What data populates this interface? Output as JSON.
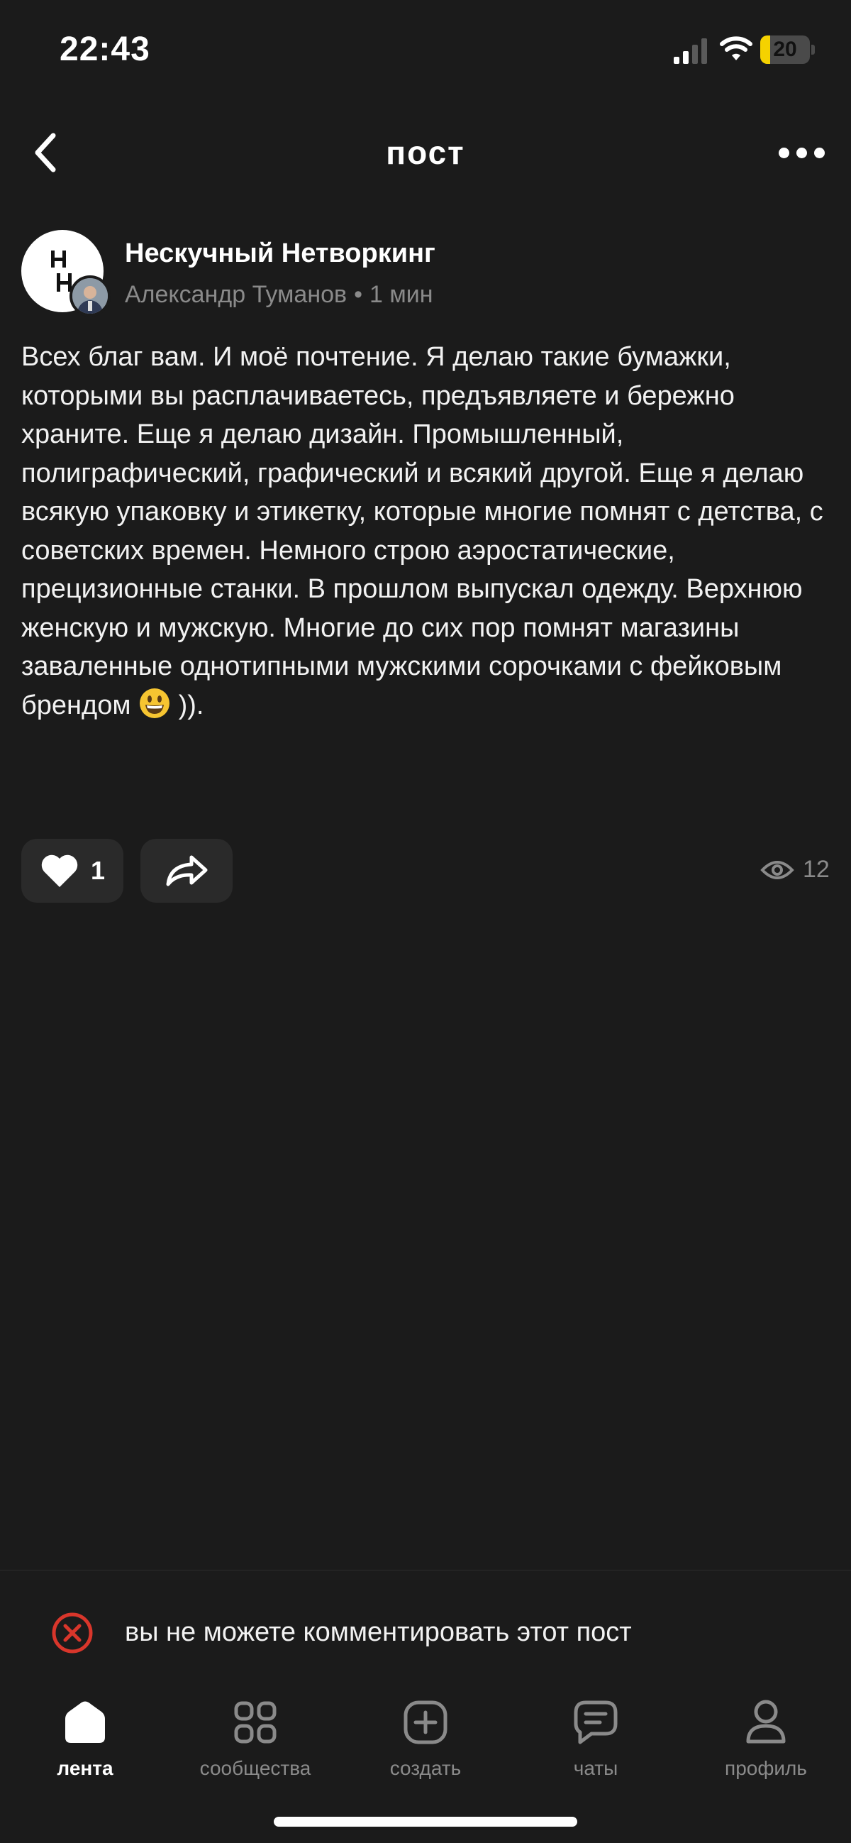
{
  "status_bar": {
    "time": "22:43",
    "battery": "20",
    "battery_level": 0.2,
    "colors": {
      "battery_fill": "#f5d200"
    },
    "icons": [
      "signal-icon",
      "wifi-icon",
      "battery-icon"
    ]
  },
  "header": {
    "title": "пост",
    "icons": [
      "chevron-left-icon",
      "more-horizontal-icon"
    ]
  },
  "post": {
    "community": "Нескучный Нетворкинг",
    "author": "Александр Туманов",
    "separator": "•",
    "time_ago": "1 мин",
    "text_main": "Всех благ вам. И моё почтение. Я делаю такие бумажки, которыми вы расплачиваетесь, предъявляете и бережно храните. Еще я делаю дизайн. Промышленный, полиграфический, графический и всякий другой. Еще я делаю всякую упаковку и этикетку, которые многие помнят с детства, с советских времен. Немного строю аэростатические, прецизионные станки. В прошлом выпускал одежду. Верхнюю женскую и мужскую. Многие до сих пор помнят магазины заваленные однотипными мужскими сорочками с фейковым брендом",
    "text_tail": " )).",
    "emoji": "smiling-face-emoji",
    "likes": "1",
    "views": "12"
  },
  "comments": {
    "disabled_text": "вы не можете комментировать этот пост",
    "colors": {
      "error_icon": "#d9362b"
    }
  },
  "nav": {
    "items": [
      {
        "label": "лента",
        "icon": "home-icon",
        "active": true
      },
      {
        "label": "сообщества",
        "icon": "grid-icon",
        "active": false
      },
      {
        "label": "создать",
        "icon": "plus-square-icon",
        "active": false
      },
      {
        "label": "чаты",
        "icon": "chat-icon",
        "active": false
      },
      {
        "label": "профиль",
        "icon": "profile-icon",
        "active": false
      }
    ]
  },
  "colors": {
    "background": "#1b1b1b",
    "surface": "#2a2a2a",
    "text_primary": "#ffffff",
    "text_secondary": "#8a8a8a"
  }
}
